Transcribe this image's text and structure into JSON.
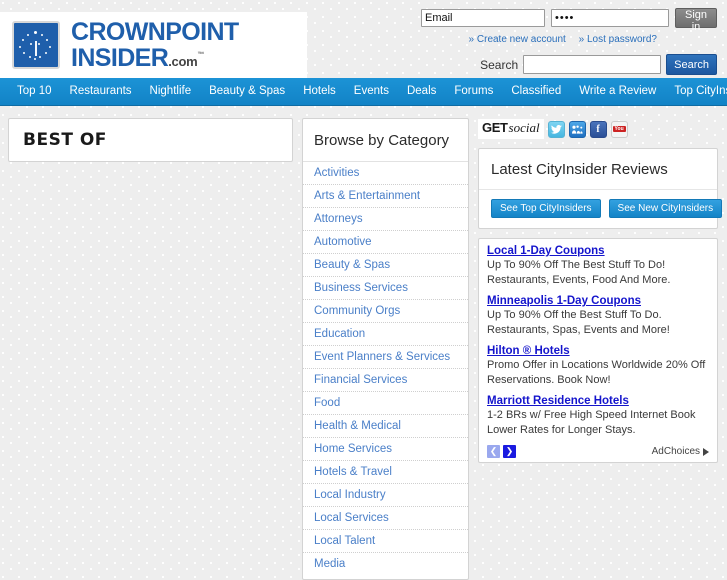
{
  "header": {
    "logo": {
      "line1": "CROWNPOINT",
      "line2": "INSIDER",
      "dotcom": ".com",
      "tm": "™",
      "mark_color": "#1f5fab",
      "text_color": "#1f5fab"
    },
    "login": {
      "email_value": "Email",
      "email_placeholder": "Email",
      "password_value": "••••",
      "signin_label": "Sign in",
      "create_account_label": "» Create new account",
      "lost_password_label": "» Lost password?"
    },
    "search": {
      "label": "Search",
      "value": "",
      "placeholder": "",
      "button_label": "Search"
    }
  },
  "nav": {
    "accent_color": "#1283c6",
    "items": [
      {
        "label": "Top 10"
      },
      {
        "label": "Restaurants"
      },
      {
        "label": "Nightlife"
      },
      {
        "label": "Beauty & Spas"
      },
      {
        "label": "Hotels"
      },
      {
        "label": "Events"
      },
      {
        "label": "Deals"
      },
      {
        "label": "Forums"
      },
      {
        "label": "Classified"
      },
      {
        "label": "Write a Review"
      },
      {
        "label": "Top CityInsiders"
      }
    ]
  },
  "best_of": {
    "title": "BEST OF"
  },
  "category": {
    "heading": "Browse by Category",
    "link_color": "#4a7fc8",
    "items": [
      {
        "label": "Activities"
      },
      {
        "label": "Arts & Entertainment"
      },
      {
        "label": "Attorneys"
      },
      {
        "label": "Automotive"
      },
      {
        "label": "Beauty & Spas"
      },
      {
        "label": "Business Services"
      },
      {
        "label": "Community Orgs"
      },
      {
        "label": "Education"
      },
      {
        "label": "Event Planners & Services"
      },
      {
        "label": "Financial Services"
      },
      {
        "label": "Food"
      },
      {
        "label": "Health & Medical"
      },
      {
        "label": "Home Services"
      },
      {
        "label": "Hotels & Travel"
      },
      {
        "label": "Local Industry"
      },
      {
        "label": "Local Services"
      },
      {
        "label": "Local Talent"
      },
      {
        "label": "Media"
      }
    ]
  },
  "sidebar": {
    "social": {
      "get_label": "GET",
      "social_label": "social",
      "icons": [
        {
          "name": "twitter-icon",
          "glyph": "t"
        },
        {
          "name": "myspace-icon",
          "glyph": "m"
        },
        {
          "name": "facebook-icon",
          "glyph": "f"
        },
        {
          "name": "youtube-icon",
          "glyph": "You"
        }
      ]
    },
    "reviews": {
      "heading": "Latest CityInsider Reviews",
      "top_button_label": "See Top CityInsiders",
      "new_button_label": "See New CityInsiders"
    },
    "ads": {
      "items": [
        {
          "title": "Local 1-Day Coupons",
          "desc": "Up To 90% Off The Best Stuff To Do! Restaurants, Events, Food And More."
        },
        {
          "title": "Minneapolis 1-Day Coupons",
          "desc": "Up To 90% Off the Best Stuff To Do. Restaurants, Spas, Events and More!"
        },
        {
          "title": "Hilton ® Hotels",
          "desc": "Promo Offer in Locations Worldwide 20% Off Reservations. Book Now!"
        },
        {
          "title": "Marriott Residence Hotels",
          "desc": "1-2 BRs w/ Free High Speed Internet Book Lower Rates for Longer Stays."
        }
      ],
      "prev_label": "❮",
      "next_label": "❯",
      "adchoices_label": "AdChoices"
    }
  }
}
